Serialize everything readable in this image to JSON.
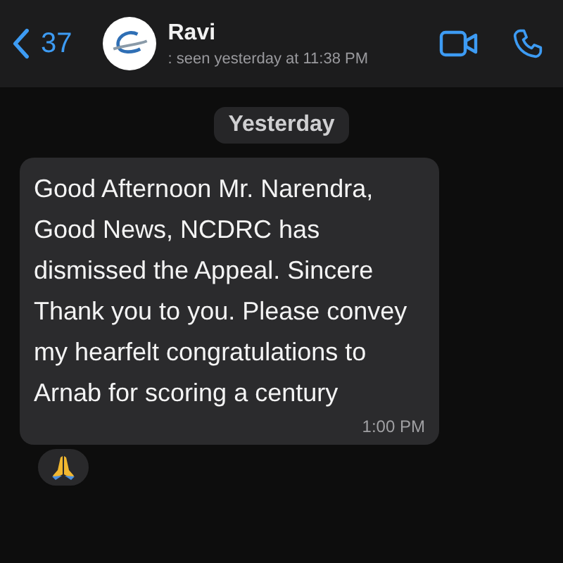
{
  "header": {
    "back_count": "37",
    "contact_name": "Ravi",
    "status": ": seen yesterday at 11:38 PM"
  },
  "date_chip": "Yesterday",
  "messages": [
    {
      "text": "Good Afternoon Mr. Narendra, Good News, NCDRC has dismissed the Appeal. Sincere Thank you to you. Please convey my hearfelt congratulations to Arnab for scoring a century",
      "time": "1:00 PM",
      "has_reaction": true
    }
  ]
}
